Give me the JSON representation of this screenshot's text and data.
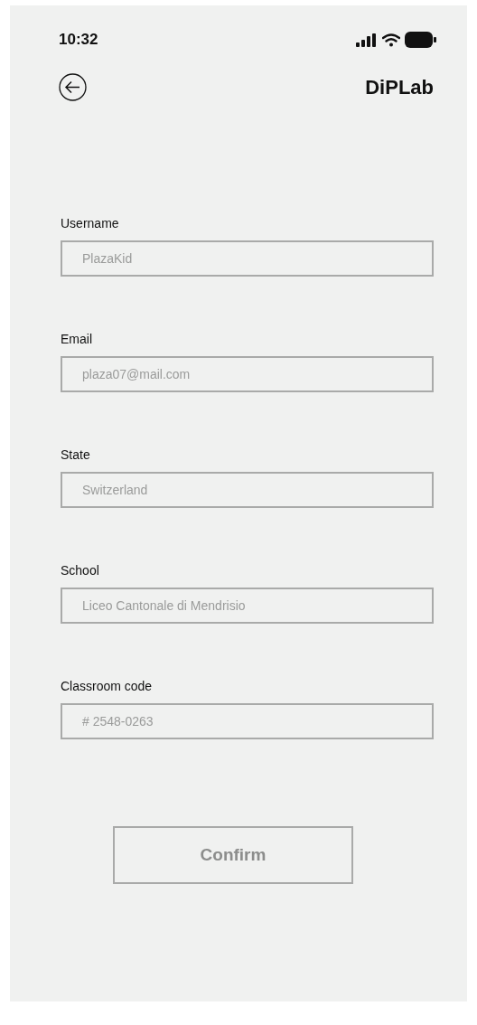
{
  "status_bar": {
    "time": "10:32"
  },
  "header": {
    "title": "DiPLab"
  },
  "fields": [
    {
      "label": "Username",
      "placeholder": "PlazaKid"
    },
    {
      "label": "Email",
      "placeholder": "plaza07@mail.com"
    },
    {
      "label": "State",
      "placeholder": "Switzerland"
    },
    {
      "label": "School",
      "placeholder": "Liceo Cantonale di Mendrisio"
    },
    {
      "label": "Classroom code",
      "placeholder": "# 2548-0263"
    }
  ],
  "confirm_button": {
    "label": "Confirm"
  }
}
